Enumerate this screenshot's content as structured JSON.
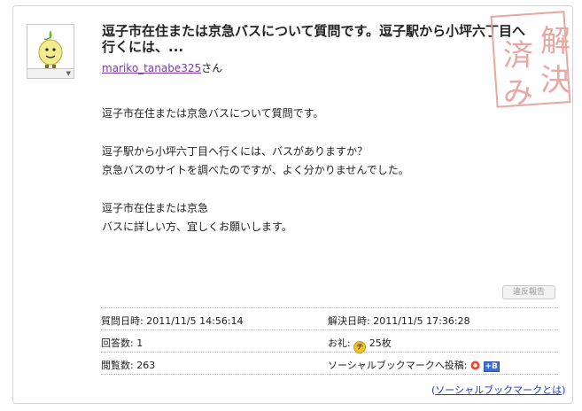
{
  "question": {
    "title": "逗子市在住または京急バスについて質問です。逗子駅から小坪六丁目へ行くには、...",
    "username": "mariko_tanabe325",
    "honorific": "さん",
    "body": [
      [
        "逗子市在住または京急バスについて質問です。"
      ],
      [
        "逗子駅から小坪六丁目へ行くには、バスがありますか？",
        "京急バスのサイトを調べたのですが、よく分かりませんでした。"
      ],
      [
        "逗子市在住または京急",
        "バスに詳しい方、宜しくお願いします。"
      ]
    ],
    "stamp_text": [
      "解",
      "決",
      "済",
      "み"
    ]
  },
  "actions": {
    "report_label": "違反報告"
  },
  "meta": {
    "asked_label": "質問日時:",
    "asked_value": "2011/11/5 14:56:14",
    "resolved_label": "解決日時:",
    "resolved_value": "2011/11/5 17:36:28",
    "answers_label": "回答数:",
    "answers_value": "1",
    "reward_label": "お礼:",
    "reward_coin": "チ",
    "reward_value": "25枚",
    "views_label": "閲覧数:",
    "views_value": "263",
    "bookmark_label": "ソーシャルブックマークへ投稿:",
    "bookmark_badge": "B"
  },
  "footer": {
    "link_open": "(",
    "link_text": "ソーシャルブックマークとは",
    "link_close": ")"
  },
  "colors": {
    "username_link": "#7b3aa8",
    "stamp": "#e8a7a0",
    "link": "#1a3dc4"
  }
}
